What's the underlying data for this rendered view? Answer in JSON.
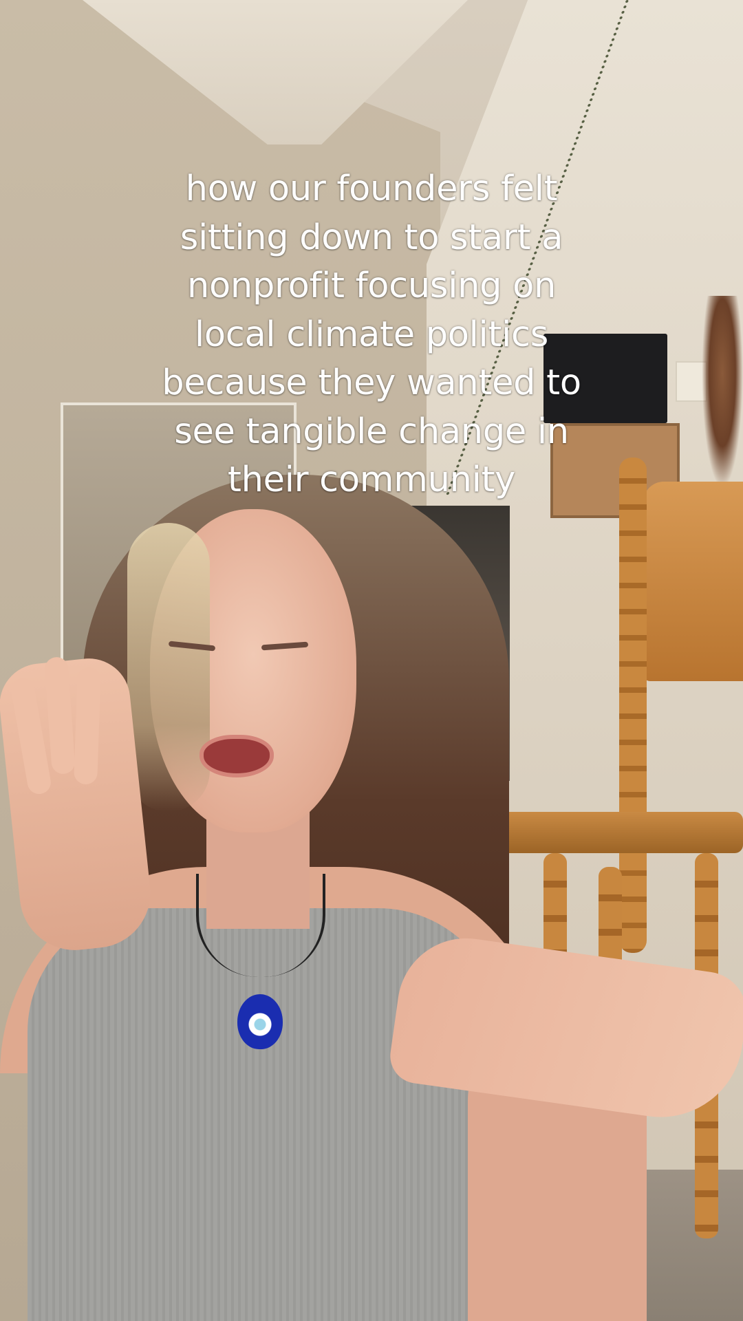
{
  "caption": {
    "lines": [
      "how our founders felt",
      "sitting down to start a",
      "nonprofit focusing on",
      "local climate politics",
      "because they wanted to",
      "see tangible change in",
      "their community"
    ]
  },
  "colors": {
    "caption_text": "#ffffff",
    "wall": "#d9cfbf",
    "chair_wood": "#c98a44",
    "tank_top": "#9f9f9c",
    "pendant_blue": "#1a2db0"
  }
}
